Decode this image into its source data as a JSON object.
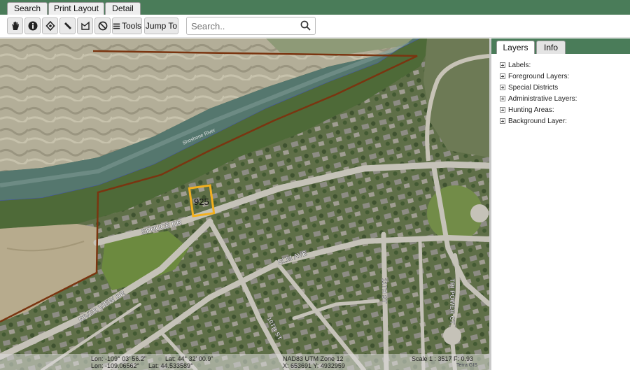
{
  "top_tabs": [
    "Search",
    "Print Layout",
    "Detail"
  ],
  "toolbar": {
    "tool_icons": [
      "pan-icon",
      "info-icon",
      "locate-icon",
      "measure-icon",
      "area-icon",
      "clear-icon"
    ],
    "tools_label": "Tools",
    "jump_to_label": "Jump To",
    "search_placeholder": "Search.."
  },
  "map": {
    "parcel_label": "925",
    "river_label": "Shoshone River",
    "street_labels": {
      "spruce": "SPRUCE DR",
      "elm": "ELM AVE",
      "river_view": "RIVER VIEW DR",
      "tenth": "10TH ST",
      "eleventh": "11TH ST",
      "tri_power": "TRI POWER CT"
    },
    "colors": {
      "boundary": "#7a3510",
      "parcel_highlight": "#f2b01e",
      "river_line": "#4455aa"
    }
  },
  "status": {
    "lon_dms": "Lon: -109° 03' 56.2\"",
    "lat_dms": "Lat: 44° 32' 00.9\"",
    "lon_dec": "Lon: -109.06562°",
    "lat_dec": "Lat: 44.533589°",
    "datum": "NAD83 UTM Zone 12",
    "xy": "X: 653691 Y: 4932959",
    "scale": "Scale 1 : 3517 F: 0.93",
    "brand": "Terra GIS"
  },
  "panel": {
    "tabs": [
      "Layers",
      "Info"
    ],
    "layers": [
      "Labels:",
      "Foreground Layers:",
      "Special Districts",
      "Administrative Layers:",
      "Hunting Areas:",
      "Background Layer:"
    ]
  }
}
